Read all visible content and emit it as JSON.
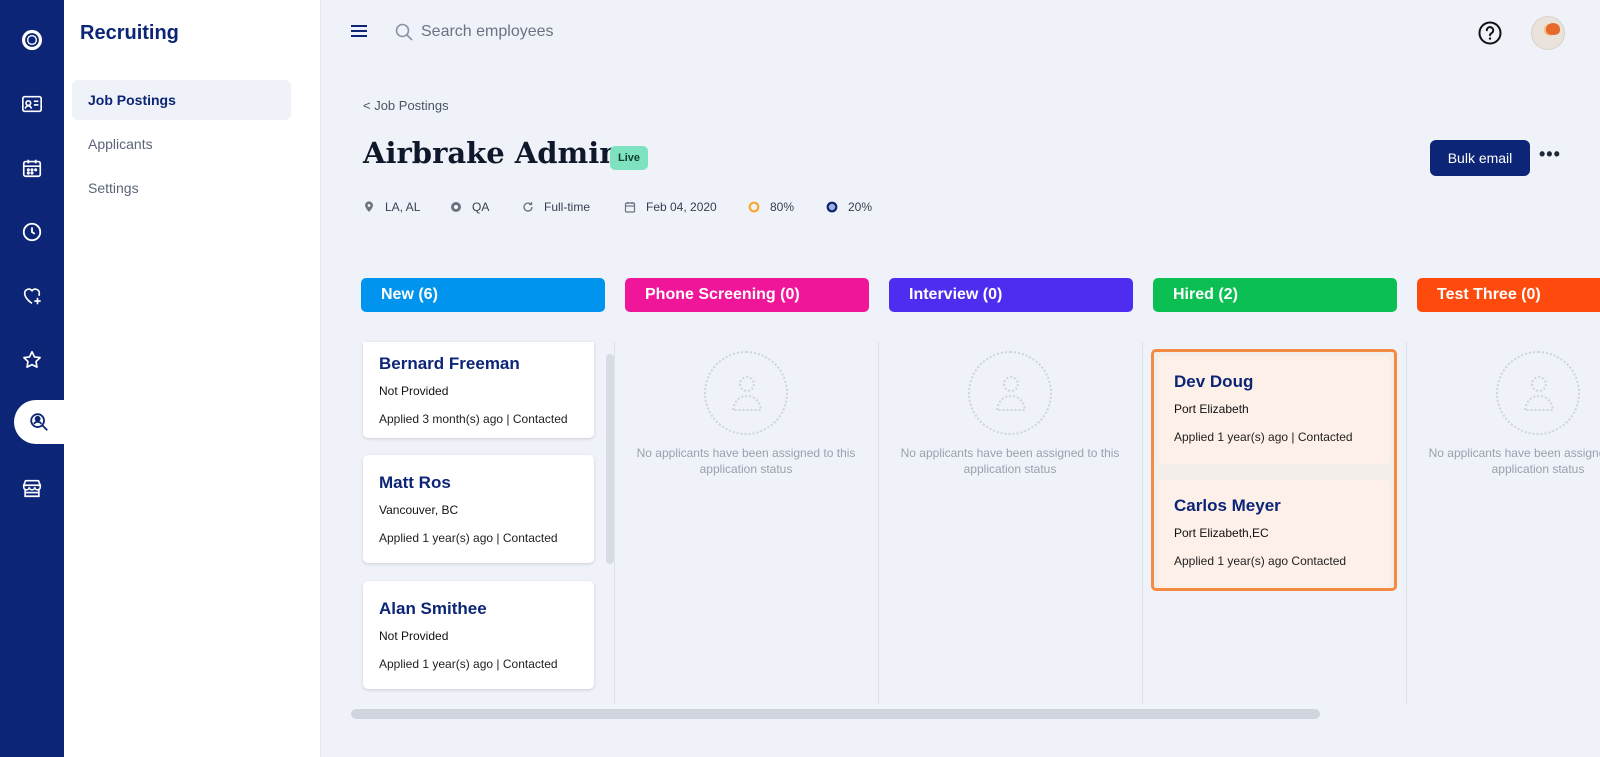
{
  "rail": {
    "items": [
      {
        "name": "logo"
      },
      {
        "name": "employee-directory"
      },
      {
        "name": "calendar"
      },
      {
        "name": "time"
      },
      {
        "name": "benefits"
      },
      {
        "name": "performance"
      },
      {
        "name": "recruiting"
      },
      {
        "name": "store"
      }
    ],
    "active": "recruiting"
  },
  "sidebar": {
    "title": "Recruiting",
    "items": [
      {
        "label": "Job Postings",
        "active": true
      },
      {
        "label": "Applicants",
        "active": false
      },
      {
        "label": "Settings",
        "active": false
      }
    ]
  },
  "topbar": {
    "search_placeholder": "Search employees"
  },
  "header": {
    "breadcrumb": "< Job Postings",
    "title": "Airbrake Admin",
    "status_badge": "Live",
    "bulk_email_label": "Bulk email",
    "more_label": "•••"
  },
  "meta": {
    "location": "LA, AL",
    "department": "QA",
    "employment_type": "Full-time",
    "date": "Feb 04, 2020",
    "stat_1": "80%",
    "stat_2": "20%"
  },
  "colors": {
    "brand": "#0c2576",
    "new": "#0094ee",
    "phone_screening": "#f0169a",
    "interview": "#4f2df0",
    "hired": "#0cbf52",
    "test_three": "#ff4a0d",
    "stat_1_ring": "#f7a934",
    "stat_2_ring": "#0c2576",
    "selection_border": "#f58a42"
  },
  "columns": [
    {
      "label": "New (6)"
    },
    {
      "label": "Phone Screening (0)"
    },
    {
      "label": "Interview (0)"
    },
    {
      "label": "Hired (2)"
    },
    {
      "label": "Test Three (0)"
    }
  ],
  "new_applicants": [
    {
      "name": "Bernard Freeman",
      "location": "Not Provided",
      "status": "Applied 3 month(s) ago | Contacted"
    },
    {
      "name": "Matt Ros",
      "location": "Vancouver, BC",
      "status": "Applied 1 year(s) ago | Contacted"
    },
    {
      "name": "Alan Smithee",
      "location": "Not Provided",
      "status": "Applied 1 year(s) ago | Contacted"
    }
  ],
  "hired_applicants": [
    {
      "name": "Dev Doug",
      "location": "Port Elizabeth",
      "status": "Applied 1 year(s) ago | Contacted"
    },
    {
      "name": "Carlos Meyer",
      "location": "Port Elizabeth,EC",
      "status": "Applied 1 year(s) ago Contacted"
    }
  ],
  "empty_state": "No applicants have been assigned to this application status"
}
